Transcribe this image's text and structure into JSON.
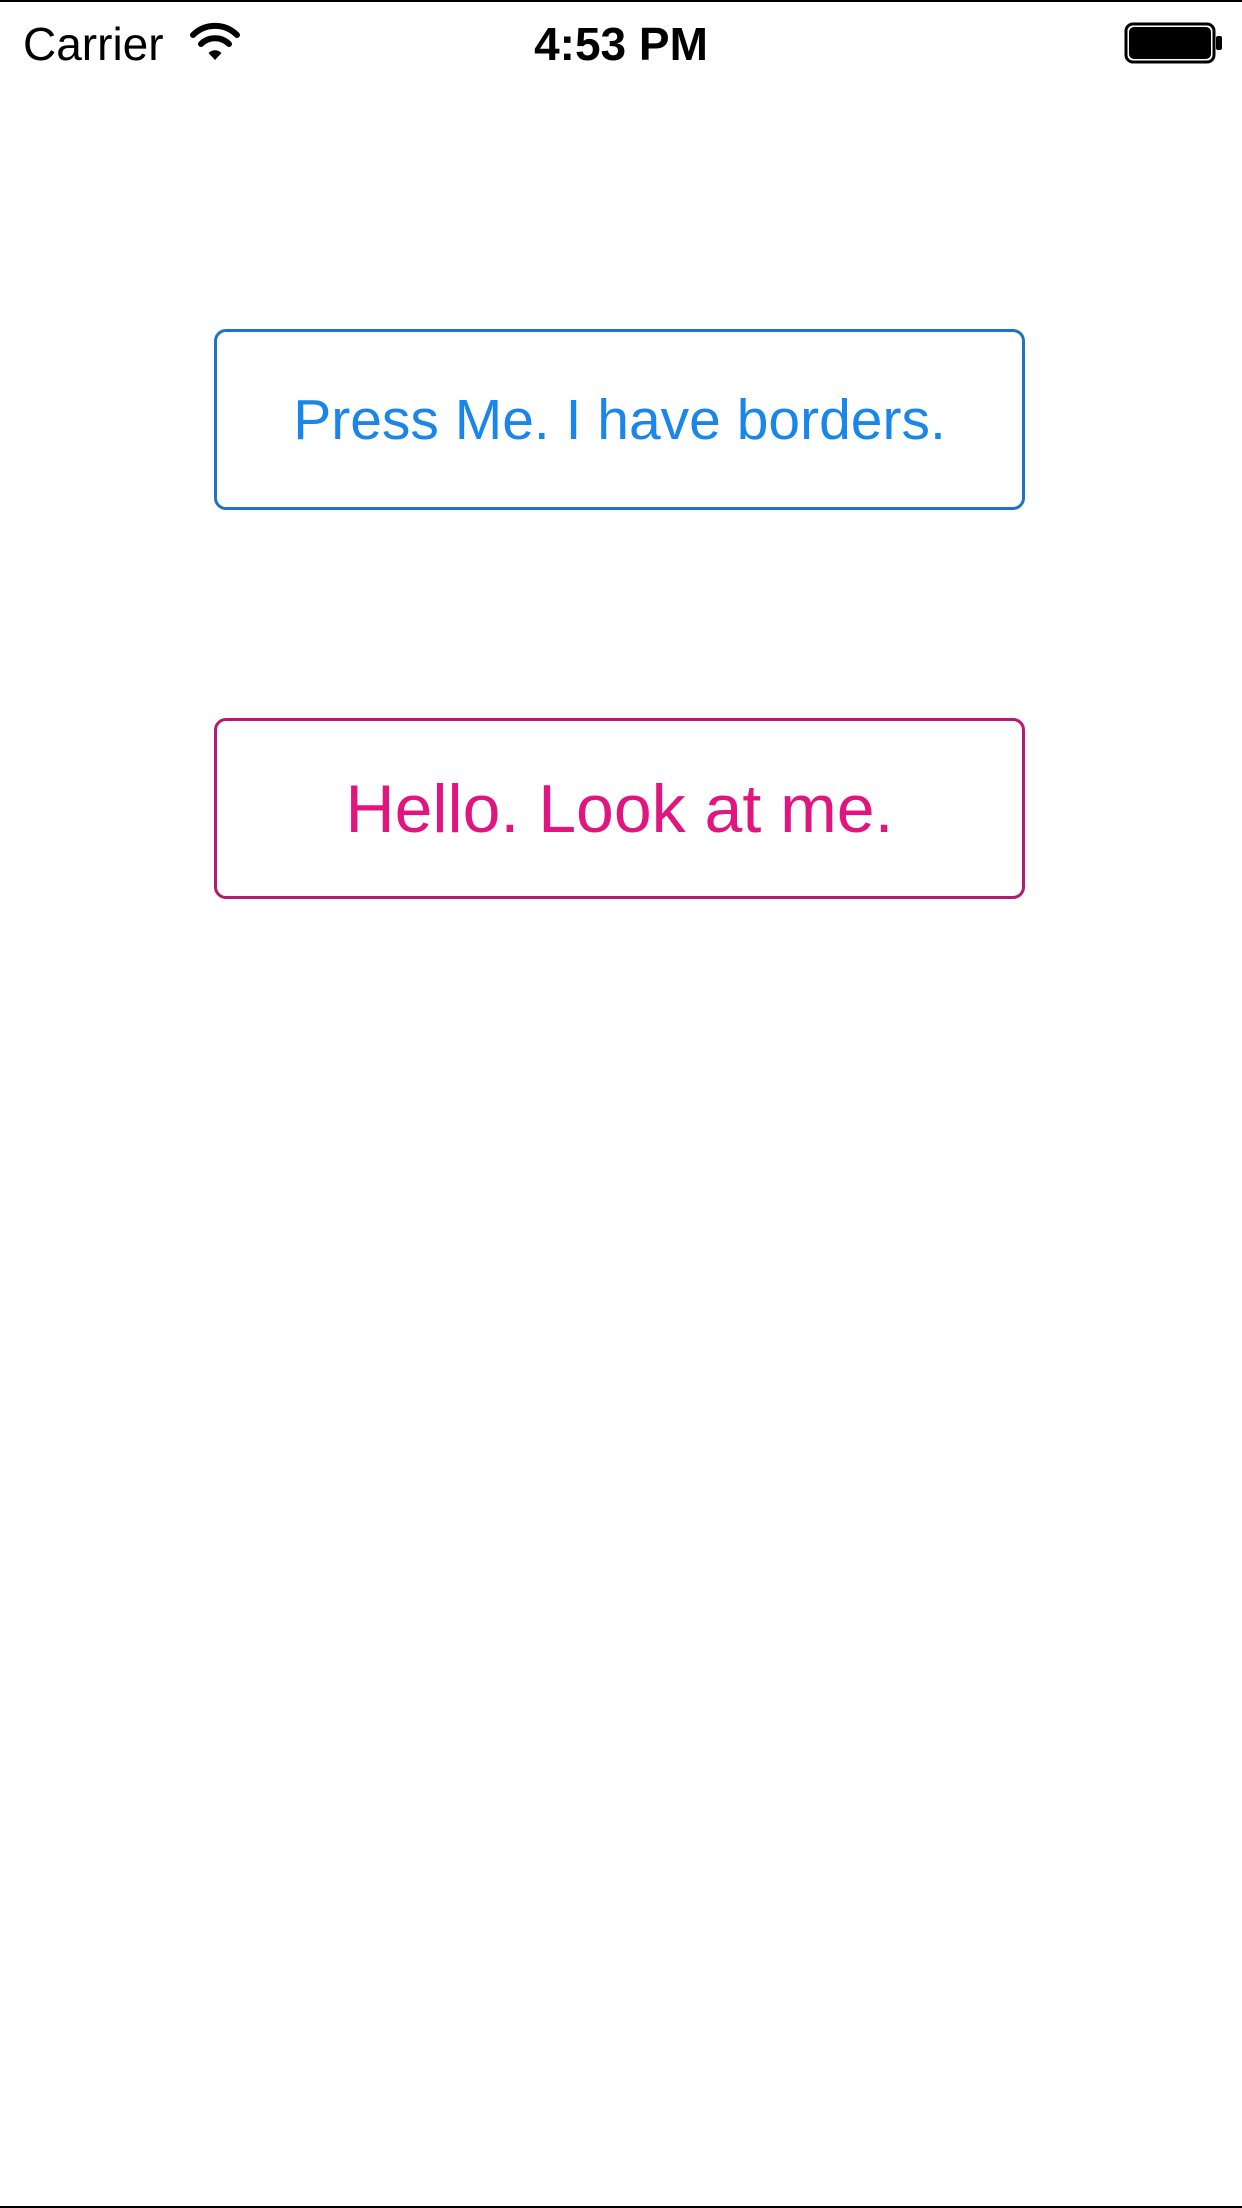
{
  "status_bar": {
    "carrier": "Carrier",
    "time": "4:53 PM",
    "wifi_icon": "wifi-icon",
    "battery_icon": "battery-icon",
    "battery_level": 1.0
  },
  "main": {
    "border_button": {
      "label": "Press Me. I have borders.",
      "text_color": "#1a86ea",
      "border_color": "#1f73c7"
    },
    "hello_button": {
      "label": "Hello. Look at me.",
      "text_color": "#e0157f",
      "border_color": "#b51b6e"
    }
  }
}
